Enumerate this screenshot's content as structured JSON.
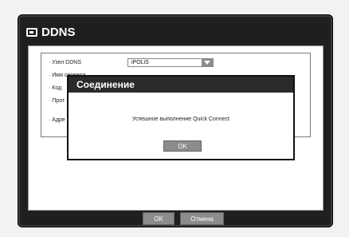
{
  "window": {
    "title": "DDNS",
    "icon": "window-icon"
  },
  "form": {
    "rows": [
      {
        "label": "· Узел DDNS"
      },
      {
        "label": "· Имя сервера"
      },
      {
        "label": "· Код"
      },
      {
        "label": "· Прот"
      },
      {
        "label": "· Адре"
      }
    ],
    "ddns_host_value": "iPOLiS"
  },
  "buttons": {
    "ok_label": "OK",
    "cancel_label": "Отмена"
  },
  "modal": {
    "title": "Соединение",
    "message": "Успешное выполнение Quick Connect",
    "ok_label": "OK"
  },
  "colors": {
    "window_bg": "#1f1f1f",
    "button": "#8c8c8c",
    "panel_bg": "#ffffff"
  }
}
